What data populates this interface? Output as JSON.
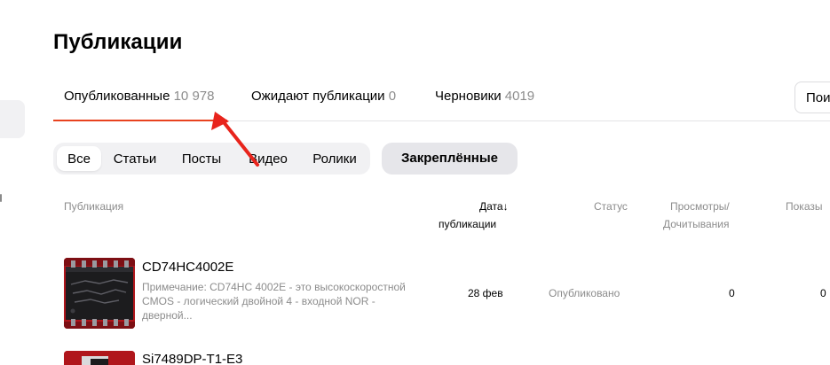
{
  "page": {
    "title": "Публикации"
  },
  "tabs": [
    {
      "label": "Опубликованные",
      "count": "10 978",
      "active": true
    },
    {
      "label": "Ожидают публикации",
      "count": "0",
      "active": false
    },
    {
      "label": "Черновики",
      "count": "4019",
      "active": false
    }
  ],
  "search": {
    "partial_text": "Пои"
  },
  "filters": [
    {
      "label": "Все",
      "active": true
    },
    {
      "label": "Статьи",
      "active": false
    },
    {
      "label": "Посты",
      "active": false
    },
    {
      "label": "Видео",
      "active": false
    },
    {
      "label": "Ролики",
      "active": false
    }
  ],
  "pinned_button": "Закреплённые",
  "table": {
    "headers": {
      "publication": "Публикация",
      "date_line1": "Дата↓",
      "date_line2": "публикации",
      "status": "Статус",
      "views_line1": "Просмотры/",
      "views_line2": "Дочитывания",
      "impressions": "Показы"
    },
    "rows": [
      {
        "title": "CD74HC4002E",
        "description": "Примечание: CD74HC 4002E - это высокоскоростной CMOS - логический двойной 4 - входной NOR - дверной...",
        "date": "28 фев",
        "status": "Опубликовано",
        "views": "0",
        "impressions": "0",
        "thumbnail": "chip-photo"
      },
      {
        "title": "Si7489DP-T1-E3",
        "thumbnail": "chip-photo"
      }
    ]
  },
  "colors": {
    "accent": "#e8431f",
    "annotation_arrow": "#e8241c",
    "muted_text": "#8c8c8c",
    "pill_background": "#f1f1f3"
  }
}
